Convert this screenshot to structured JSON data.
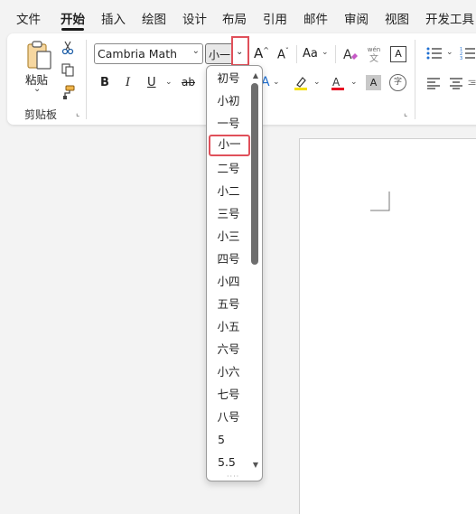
{
  "tabs": [
    "文件",
    "开始",
    "插入",
    "绘图",
    "设计",
    "布局",
    "引用",
    "邮件",
    "审阅",
    "视图",
    "开发工具"
  ],
  "active_tab": "开始",
  "clipboard": {
    "paste_label": "粘贴",
    "group_label": "剪贴板"
  },
  "font": {
    "name": "Cambria Math",
    "size": "小一"
  },
  "font_size_options": [
    "初号",
    "小初",
    "一号",
    "小一",
    "二号",
    "小二",
    "三号",
    "小三",
    "四号",
    "小四",
    "五号",
    "小五",
    "六号",
    "小六",
    "七号",
    "八号",
    "5",
    "5.5"
  ],
  "selected_size": "小一",
  "format_buttons": {
    "bold": "B",
    "italic": "I",
    "underline": "U",
    "strike": "ab",
    "grow": "A",
    "shrink": "A",
    "case": "Aa",
    "phonetic": "wén",
    "phonetic_char": "文",
    "charborder": "A",
    "charshade": "A",
    "enclose": "字"
  },
  "colors": {
    "accent_red": "#e0505a",
    "highlight": "#f5e000",
    "font_color": "#e81123",
    "scrollbar": "#6e6e6e"
  }
}
